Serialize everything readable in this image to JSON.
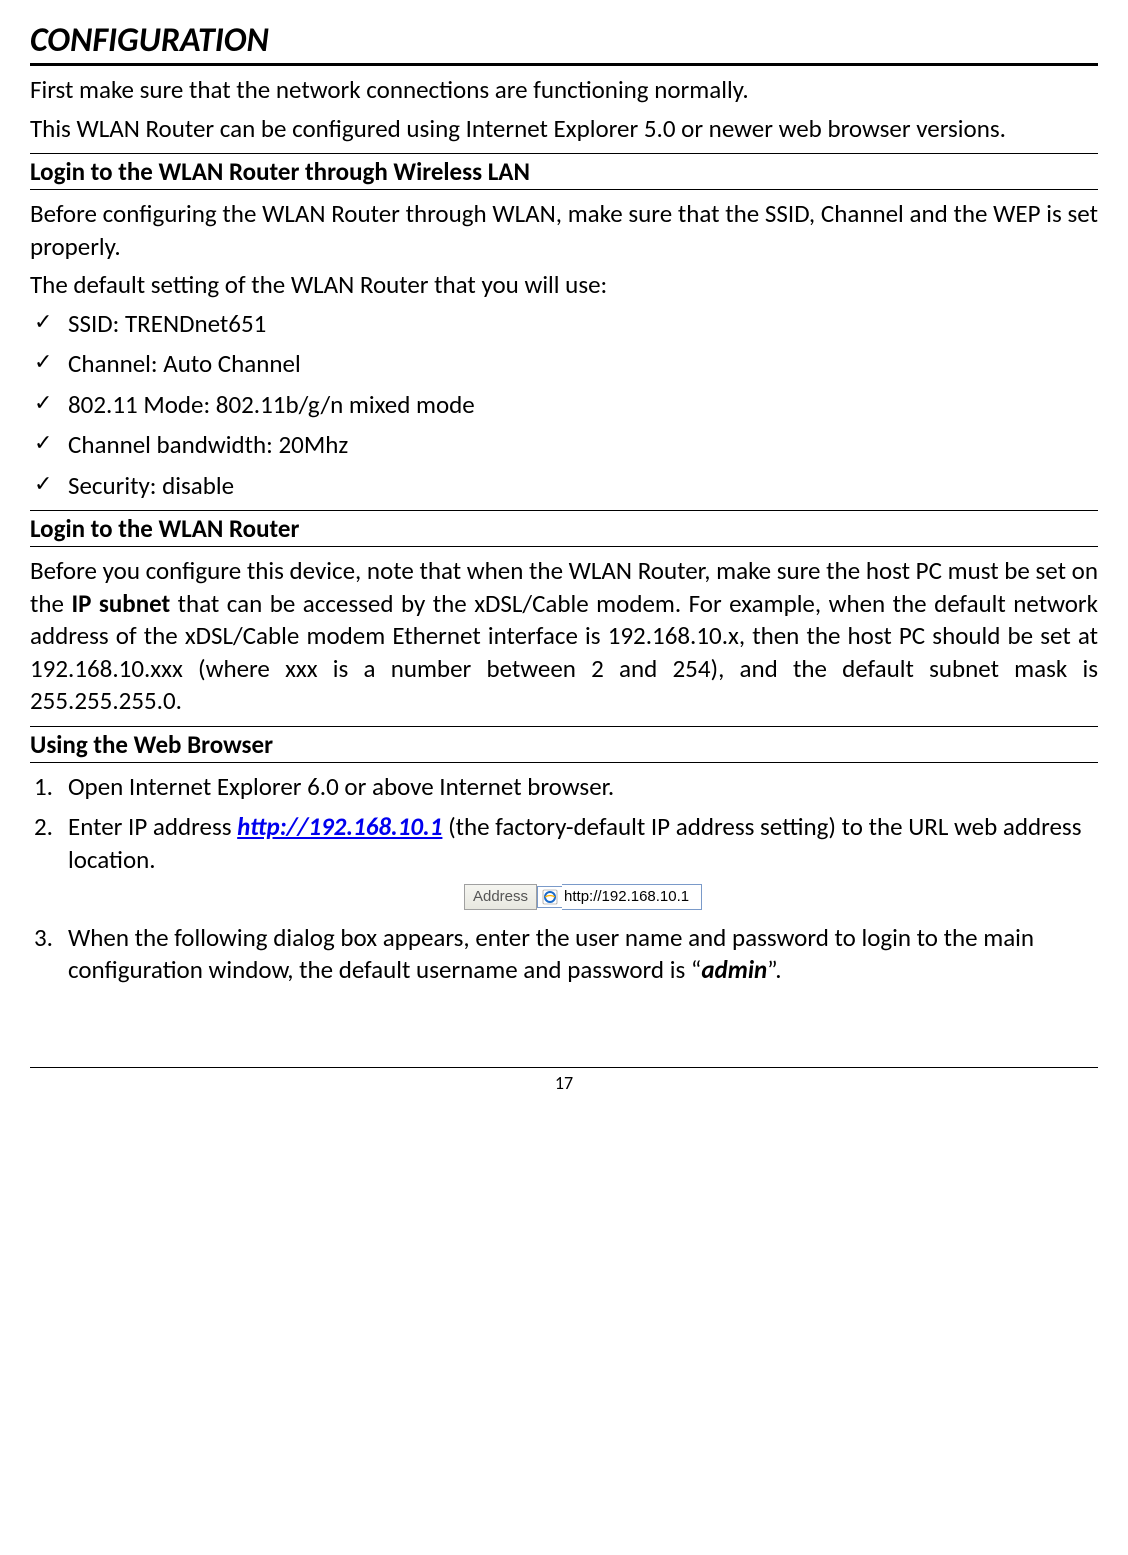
{
  "title": "CONFIGURATION",
  "intro1": "First make sure that the network connections are functioning normally.",
  "intro2": "This WLAN Router can be configured using Internet Explorer 5.0 or newer web browser versions.",
  "section1": {
    "heading": "Login to the WLAN Router through Wireless LAN",
    "para1": "Before configuring the WLAN Router through WLAN, make sure that the SSID, Channel and the WEP is set properly.",
    "para2": "The default setting of the WLAN Router that you will use:",
    "items": [
      "SSID: TRENDnet651",
      "Channel: Auto Channel",
      "802.11 Mode: 802.11b/g/n mixed mode",
      "Channel bandwidth: 20Mhz",
      "Security: disable"
    ]
  },
  "section2": {
    "heading": "Login to the WLAN Router",
    "para_pre": "Before you configure this device, note that when the WLAN Router, make sure the host PC must be set on the ",
    "para_bold": "IP subnet",
    "para_post": " that can be accessed by the xDSL/Cable modem. For example, when the default network address of the xDSL/Cable modem Ethernet interface is 192.168.10.x, then the host PC should be set at 192.168.10.xxx (where xxx is a number between 2 and 254), and the default subnet mask is 255.255.255.0."
  },
  "section3": {
    "heading": "Using the Web Browser",
    "step1": "Open Internet Explorer 6.0 or above Internet browser.",
    "step2_pre": "Enter IP address ",
    "step2_link": "http://192.168.10.1",
    "step2_post": " (the factory-default IP address setting) to the URL web address location.",
    "addressbar": {
      "label": "Address",
      "url": "http://192.168.10.1"
    },
    "step3_pre": "When the following dialog box appears, enter the user name and password to login to the main configuration window, the default username and password is “",
    "step3_bold": "admin",
    "step3_post": "”."
  },
  "page_number": "17"
}
